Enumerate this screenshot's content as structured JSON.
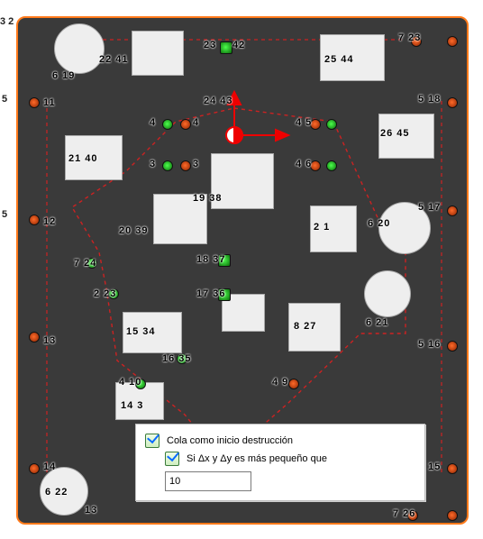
{
  "axes": {
    "left_top": "3  2",
    "left_mid1": "5",
    "left_mid2": "5"
  },
  "panel": {
    "check1_label": "Cola como inicio destrucción",
    "check2_label": "Si Δx y Δy es más pequeño que",
    "check1_on": true,
    "check2_on": true,
    "value": "10"
  },
  "labels": {
    "t_23": "23",
    "t_42": "42",
    "t_7_23": "7  23",
    "t_22_41": "22  41",
    "t_25_44": "25  44",
    "t_6_19": "6  19",
    "t_24_43": "24  43",
    "t_5_18": "5  18",
    "t_11": "11",
    "t_4_4": "4",
    "t_4m": "4",
    "t_4_5": "4  5",
    "t_26_45": "26  45",
    "t_21_40": "21  40",
    "t_3_3": "3",
    "t_3m": "3",
    "t_4_6": "4  6",
    "t_12": "12",
    "t_19_38": "19  38",
    "t_5_17": "5  17",
    "t_20_39": "20  39",
    "t_2_1": "2  1",
    "t_6_20": "6  20",
    "t_7_24": "7  24",
    "t_18_37": "18  37",
    "t_2_23": "2  23",
    "t_17_36": "17  36",
    "t_15_34": "15  34",
    "t_8_27": "8  27",
    "t_6_21": "6  21",
    "t_13": "13",
    "t_16_35": "16  35",
    "t_5_16": "5  16",
    "t_4_10": "4  10",
    "t_4_9": "4  9",
    "t_14_3": "14  3",
    "t_14": "14",
    "t_5_15": "5  15",
    "t_6_22": "6  22",
    "t_13b": "13",
    "t_7_26": "7  26"
  }
}
